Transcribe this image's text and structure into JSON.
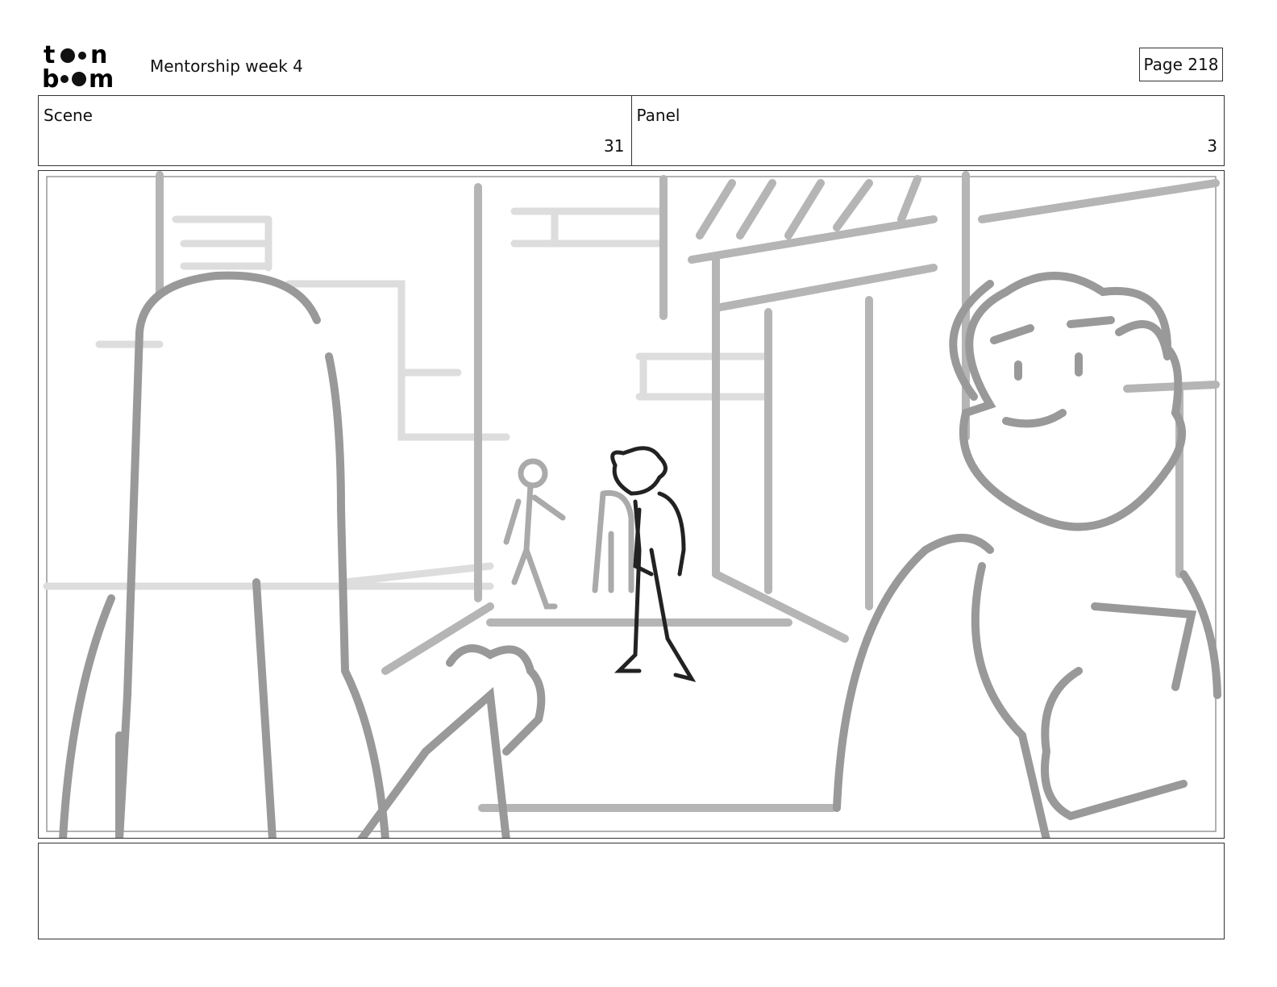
{
  "header": {
    "logo_text": "toon boom",
    "project_title": "Mentorship week 4",
    "page_label": "Page 218"
  },
  "info": {
    "scene_label": "Scene",
    "scene_value": "31",
    "panel_label": "Panel",
    "panel_value": "3"
  },
  "notes": {
    "text": ""
  }
}
